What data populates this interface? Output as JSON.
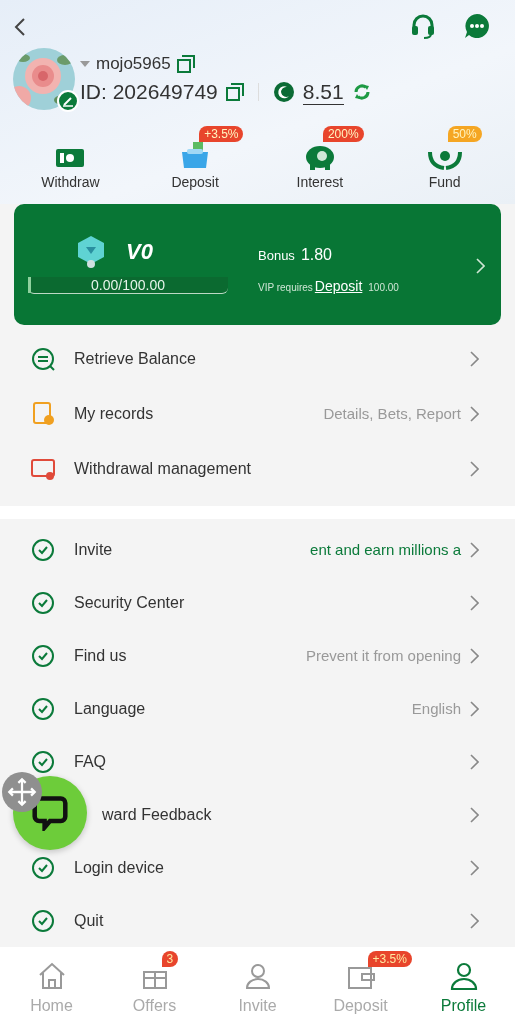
{
  "header": {
    "username": "mojo5965",
    "user_id": "ID: 202649749",
    "balance": "8.51"
  },
  "quick_actions": [
    {
      "label": "Withdraw"
    },
    {
      "label": "Deposit",
      "badge": "+3.5%",
      "color": "#e8452c"
    },
    {
      "label": "Interest",
      "badge": "200%",
      "color": "#e8452c"
    },
    {
      "label": "Fund",
      "badge": "50%",
      "color": "#f5a623"
    }
  ],
  "vip_card": {
    "level_name": "V0",
    "progress": "0.00/100.00",
    "level": 0,
    "bonus_label": "Bonus",
    "bonus": "1.80",
    "requires": "VIP requires",
    "link": "Deposit",
    "amount": "100.00"
  },
  "menu_groups": [
    {
      "items": [
        {
          "label": "Retrieve Balance"
        },
        {
          "label": "My records",
          "value": "Details, Bets, Report"
        },
        {
          "label": "Withdrawal management"
        }
      ]
    },
    {
      "items": [
        {
          "label": "Invite",
          "value": "ent and earn millions a",
          "highlight": true
        },
        {
          "label": "Security Center"
        },
        {
          "label": "Find us",
          "value": "Prevent it from opening"
        },
        {
          "label": "Language",
          "value": "English"
        },
        {
          "label": "FAQ"
        },
        {
          "label": "ward Feedback",
          "covered": true
        },
        {
          "label": "Login device"
        },
        {
          "label": "Quit"
        }
      ]
    }
  ],
  "bottom_nav": [
    {
      "label": "Home",
      "selected": false
    },
    {
      "label": "Offers",
      "badge": "3",
      "selected": false
    },
    {
      "label": "Invite",
      "selected": false
    },
    {
      "label": "Deposit",
      "badge": "+3.5%",
      "selected": false
    },
    {
      "label": "Profile",
      "selected": true
    }
  ]
}
